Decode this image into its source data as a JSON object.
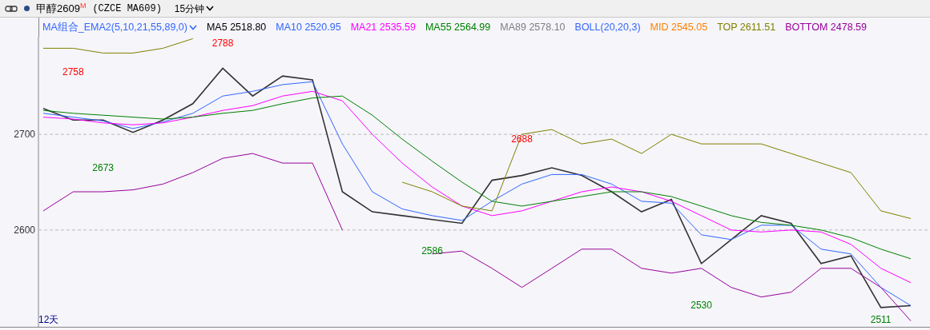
{
  "header": {
    "title": "甲醇2609$^{M}$",
    "code": "(CZCE MA609)",
    "period": "15分钟"
  },
  "legend": [
    {
      "text": "MA组合_EMA2(5,10,21,55,89,0)",
      "color": "#3366ff",
      "kind": "selector"
    },
    {
      "text": "MA5 2518.80",
      "color": "#000000",
      "kind": "value"
    },
    {
      "text": "MA10 2520.95",
      "color": "#3366ff",
      "kind": "value"
    },
    {
      "text": "MA21 2535.59",
      "color": "#ff00ff",
      "kind": "value"
    },
    {
      "text": "MA55 2564.99",
      "color": "#008000",
      "kind": "value"
    },
    {
      "text": "MA89 2578.10",
      "color": "#808080",
      "kind": "value"
    },
    {
      "text": "BOLL(20,20,3)",
      "color": "#3366ff",
      "kind": "value"
    },
    {
      "text": "MID 2545.05",
      "color": "#ff8000",
      "kind": "value"
    },
    {
      "text": "TOP 2611.51",
      "color": "#808000",
      "kind": "value"
    },
    {
      "text": "BOTTOM 2478.59",
      "color": "#990099",
      "kind": "value"
    }
  ],
  "chart": {
    "footer_label": "12天",
    "price_marks": [
      {
        "text": "2758",
        "color": "#ff0000"
      },
      {
        "text": "2788",
        "color": "#ff0000"
      },
      {
        "text": "2673",
        "color": "#008000"
      },
      {
        "text": "2688",
        "color": "#ff0000"
      },
      {
        "text": "2586",
        "color": "#008000"
      },
      {
        "text": "2530",
        "color": "#008000"
      },
      {
        "text": "2511",
        "color": "#008000"
      }
    ],
    "chart_data": {
      "type": "line",
      "ylim": [
        2498,
        2802
      ],
      "yticks": [
        2600,
        2700
      ],
      "series": [
        {
          "color": "#333333",
          "values": [
            2727,
            2715,
            2715,
            2702,
            2715,
            2732,
            2769,
            2740,
            2761,
            2757,
            2640,
            2619,
            2615,
            2611,
            2607,
            2652,
            2657,
            2665,
            2657,
            2640,
            2619,
            2632,
            2565,
            2590,
            2615,
            2607,
            2565,
            2573,
            2519,
            2521
          ]
        },
        {
          "color": "#3366ff",
          "values": [
            2722,
            2718,
            2714,
            2706,
            2713,
            2722,
            2740,
            2745,
            2752,
            2755,
            2690,
            2640,
            2622,
            2615,
            2610,
            2630,
            2648,
            2658,
            2658,
            2648,
            2630,
            2628,
            2595,
            2590,
            2605,
            2605,
            2580,
            2575,
            2540,
            2521
          ]
        },
        {
          "color": "#ff00ff",
          "values": [
            2718,
            2716,
            2712,
            2710,
            2712,
            2718,
            2725,
            2730,
            2740,
            2745,
            2735,
            2700,
            2670,
            2645,
            2625,
            2615,
            2620,
            2630,
            2640,
            2645,
            2640,
            2630,
            2615,
            2600,
            2598,
            2600,
            2598,
            2585,
            2560,
            2545
          ]
        },
        {
          "color": "#008000",
          "values": [
            2725,
            2722,
            2720,
            2718,
            2716,
            2718,
            2722,
            2725,
            2732,
            2738,
            2740,
            2720,
            2695,
            2672,
            2650,
            2630,
            2625,
            2630,
            2635,
            2640,
            2640,
            2635,
            2625,
            2615,
            2608,
            2605,
            2600,
            2592,
            2580,
            2570
          ]
        },
        {
          "color": "#808000",
          "values": [
            2790,
            2790,
            2785,
            2785,
            2790,
            2800,
            null,
            null,
            null,
            null,
            null,
            null,
            2650,
            2640,
            2625,
            2620,
            2700,
            2705,
            2690,
            2695,
            2680,
            2700,
            2690,
            2690,
            2690,
            2680,
            2670,
            2660,
            2620,
            2612
          ]
        },
        {
          "color": "#990099",
          "values": [
            2620,
            2640,
            2640,
            2642,
            2648,
            2660,
            2675,
            2680,
            2670,
            2670,
            2600,
            null,
            null,
            2575,
            2578,
            2560,
            2540,
            2560,
            2580,
            2580,
            2560,
            2555,
            2560,
            2540,
            2530,
            2535,
            2560,
            2560,
            2540,
            2505
          ]
        }
      ]
    }
  }
}
